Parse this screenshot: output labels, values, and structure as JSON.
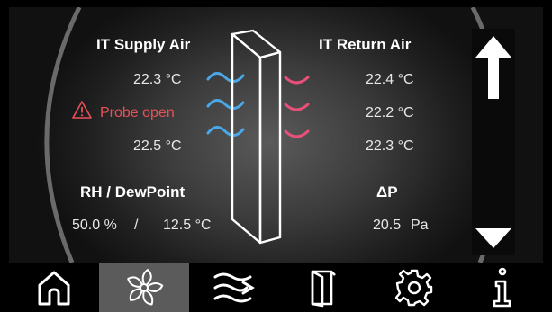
{
  "supply": {
    "title": "IT Supply Air",
    "temp_top": "22.3 °C",
    "probe_warning": "Probe open",
    "temp_bottom": "22.5 °C"
  },
  "return_air": {
    "title": "IT Return Air",
    "temp_top": "22.4 °C",
    "temp_mid": "22.2 °C",
    "temp_bottom": "22.3 °C"
  },
  "humidity": {
    "title": "RH / DewPoint",
    "rh_value": "50.0 %",
    "separator": "/",
    "dewpoint_value": "12.5 °C"
  },
  "pressure": {
    "title": "ΔP",
    "value": "20.5",
    "unit": "Pa"
  },
  "nav": {
    "items": [
      {
        "icon": "home-icon",
        "active": false
      },
      {
        "icon": "fan-icon",
        "active": true
      },
      {
        "icon": "airflow-icon",
        "active": false
      },
      {
        "icon": "door-icon",
        "active": false
      },
      {
        "icon": "gear-icon",
        "active": false
      },
      {
        "icon": "info-icon",
        "active": false
      }
    ]
  },
  "colors": {
    "accent_cold": "#4aa8e8",
    "accent_warm": "#e8507a",
    "warning": "#e8505a",
    "active_tab": "#5b5b5b"
  }
}
